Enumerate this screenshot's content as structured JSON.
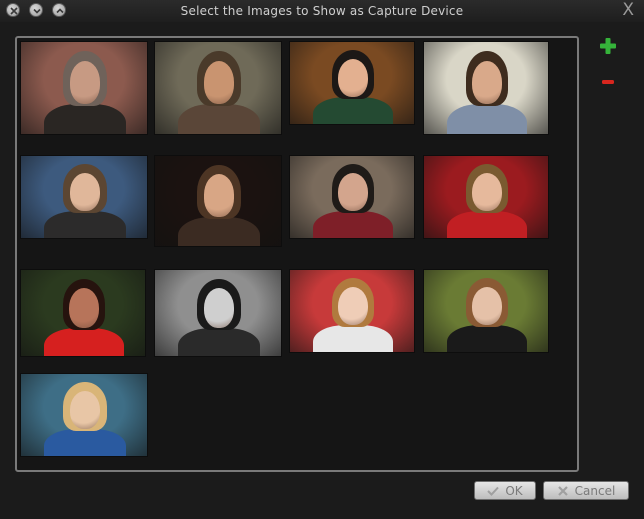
{
  "window": {
    "title": "Select the Images to Show as Capture Device",
    "close_glyph": "X"
  },
  "toolbar": {
    "add_icon": "plus-icon",
    "remove_icon": "minus-icon"
  },
  "buttons": {
    "ok_label": "OK",
    "cancel_label": "Cancel"
  },
  "images": [
    {
      "id": "1",
      "bg": "#8c5a4e",
      "skin": "#c79a83",
      "hair": "#6f625a",
      "shirt": "#2a2623"
    },
    {
      "id": "2",
      "bg": "#6f6a58",
      "skin": "#c99470",
      "hair": "#4a3a2a",
      "shirt": "#5a4638"
    },
    {
      "id": "3",
      "bg": "#7a4a22",
      "skin": "#e3b090",
      "hair": "#1c1816",
      "shirt": "#244a32"
    },
    {
      "id": "4",
      "bg": "#d9d6c7",
      "skin": "#d9a98a",
      "hair": "#3e2c1e",
      "shirt": "#7f8fa7"
    },
    {
      "id": "5",
      "bg": "#3d5a7e",
      "skin": "#e0b79a",
      "hair": "#5c4632",
      "shirt": "#2c2b2b"
    },
    {
      "id": "6",
      "bg": "#1b1210",
      "skin": "#d8a685",
      "hair": "#4d3524",
      "shirt": "#3b2b22"
    },
    {
      "id": "7",
      "bg": "#7a6b5c",
      "skin": "#d3a58d",
      "hair": "#1f1b18",
      "shirt": "#7e1f28"
    },
    {
      "id": "8",
      "bg": "#9b1b1f",
      "skin": "#e6b99c",
      "hair": "#7a5a30",
      "shirt": "#c11f23"
    },
    {
      "id": "9",
      "bg": "#2b3a1f",
      "skin": "#b7745a",
      "hair": "#26130e",
      "shirt": "#d6201f"
    },
    {
      "id": "10",
      "bg": "#8f8f8f",
      "skin": "#cfcfcf",
      "hair": "#1a1a1a",
      "shirt": "#2a2a2a"
    },
    {
      "id": "11",
      "bg": "#c73a3a",
      "skin": "#efcdb7",
      "hair": "#b07a3e",
      "shirt": "#e7e7e7"
    },
    {
      "id": "12",
      "bg": "#6a7b34",
      "skin": "#e5c1a8",
      "hair": "#8a5a34",
      "shirt": "#1a1a1a"
    },
    {
      "id": "13",
      "bg": "#3e6e86",
      "skin": "#e8c6a6",
      "hair": "#d9b578",
      "shirt": "#2a5aa0"
    }
  ]
}
